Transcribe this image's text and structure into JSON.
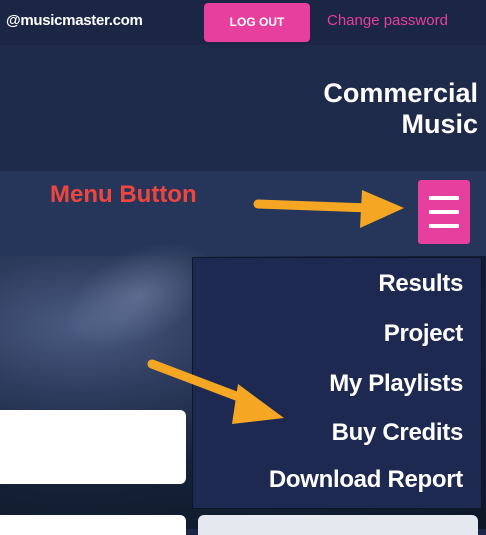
{
  "topbar": {
    "user_email": "@musicmaster.com",
    "logout_label": "LOG OUT",
    "change_password_label": "Change password"
  },
  "header": {
    "brand_line1": "Commercial",
    "brand_line2": "Music"
  },
  "annotation": {
    "menu_button_label": "Menu Button",
    "color": "#f0453d",
    "arrow_color": "#f5a623"
  },
  "menu": {
    "icon": "hamburger-icon",
    "items": [
      {
        "label": "Results"
      },
      {
        "label": "Project"
      },
      {
        "label": "My Playlists"
      },
      {
        "label": "Buy Credits"
      },
      {
        "label": "Download Report"
      }
    ]
  },
  "colors": {
    "accent": "#e63f9e",
    "navy": "#1e2a4a"
  }
}
